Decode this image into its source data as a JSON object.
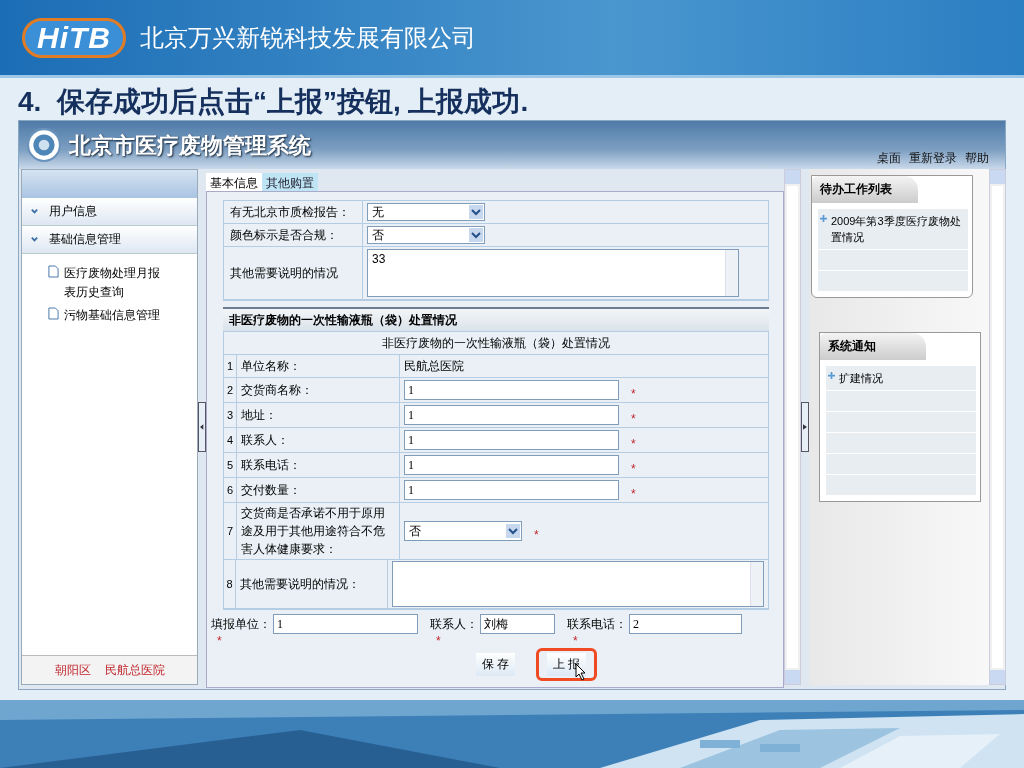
{
  "slide": {
    "logo": "HiTB",
    "company": "北京万兴新锐科技发展有限公司",
    "title": "4.  保存成功后点击“上报”按钮, 上报成功."
  },
  "app": {
    "title": "北京市医疗废物管理系统",
    "top_links": [
      "桌面",
      "重新登录",
      "帮助"
    ],
    "sidebar": {
      "groups": [
        {
          "label": "用户信息"
        },
        {
          "label": "基础信息管理"
        }
      ],
      "items": [
        {
          "label": "医疗废物处理月报表历史查询"
        },
        {
          "label": "污物基础信息管理"
        }
      ],
      "footer": [
        "朝阳区",
        "民航总医院"
      ]
    },
    "tabs": [
      {
        "label": "基本信息",
        "selected": true
      },
      {
        "label": "其他购置",
        "selected": false
      }
    ],
    "upper_rows": [
      {
        "label": "有无北京市质检报告：",
        "kind": "select",
        "value": "无"
      },
      {
        "label": "颜色标示是否合规：",
        "kind": "select",
        "value": "否"
      },
      {
        "label": "其他需要说明的情况",
        "kind": "textarea",
        "value": "33"
      }
    ],
    "section": {
      "title": "非医疗废物的一次性输液瓶（袋）处置情况",
      "subtitle": "非医疗废物的一次性输液瓶（袋）处置情况",
      "rows": [
        {
          "number": "1",
          "label": "单位名称：",
          "kind": "text",
          "value": "民航总医院"
        },
        {
          "number": "2",
          "label": "交货商名称：",
          "kind": "input",
          "value": "1",
          "mark": "*"
        },
        {
          "number": "3",
          "label": "地址：",
          "kind": "input",
          "value": "1",
          "mark": "*"
        },
        {
          "number": "4",
          "label": "联系人：",
          "kind": "input",
          "value": "1",
          "mark": "*"
        },
        {
          "number": "5",
          "label": "联系电话：",
          "kind": "input",
          "value": "1",
          "mark": "*"
        },
        {
          "number": "6",
          "label": "交付数量：",
          "kind": "input",
          "value": "1",
          "mark": "*"
        },
        {
          "number": "7",
          "label": "交货商是否承诺不用于原用途及用于其他用途符合不危害人体健康要求：",
          "kind": "select",
          "value": "否",
          "mark": "*"
        },
        {
          "number": "8",
          "label": "其他需要说明的情况：",
          "kind": "textarea",
          "value": ""
        }
      ]
    },
    "footer_fields": [
      {
        "label": "填报单位：",
        "value": "1",
        "mark": "*"
      },
      {
        "label": "联系人：",
        "value": "刘梅",
        "mark": "*"
      },
      {
        "label": "联系电话：",
        "value": "2",
        "mark": "*"
      }
    ],
    "buttons": [
      {
        "label": "保 存",
        "highlighted": false
      },
      {
        "label": "上 报",
        "highlighted": true
      }
    ],
    "todo": {
      "title": "待办工作列表",
      "items": [
        "2009年第3季度医疗废物处置情况"
      ]
    },
    "notices": {
      "title": "系统通知",
      "items": [
        "扩建情况"
      ]
    }
  }
}
